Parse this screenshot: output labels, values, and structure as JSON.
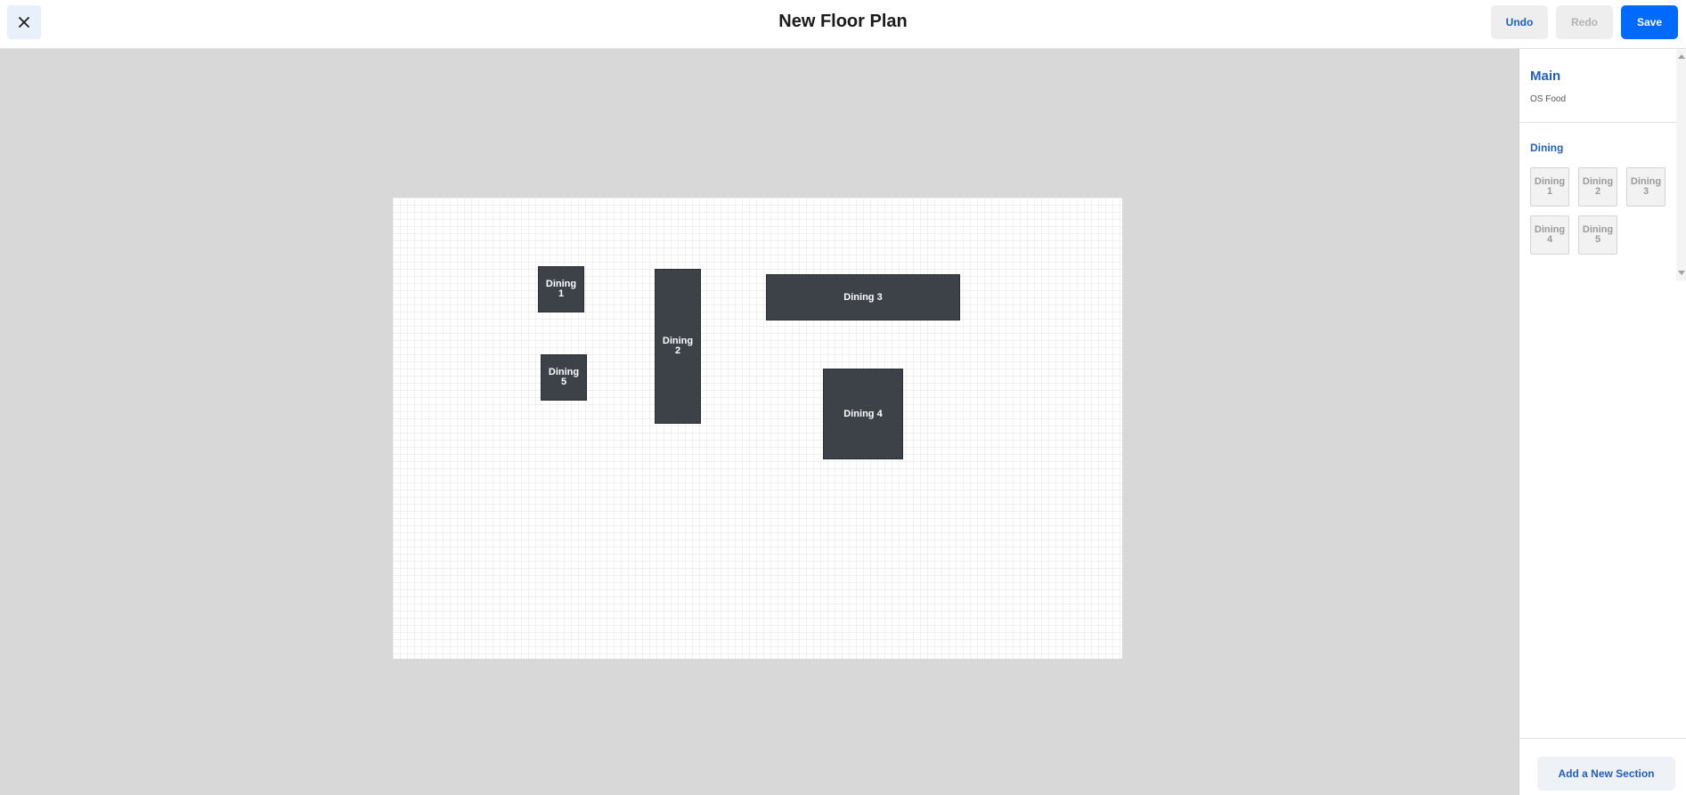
{
  "header": {
    "title": "New Floor Plan",
    "undo_label": "Undo",
    "redo_label": "Redo",
    "save_label": "Save"
  },
  "canvas": {
    "tables": [
      {
        "line1": "Dining",
        "line2": "1"
      },
      {
        "line1": "Dining",
        "line2": "2"
      },
      {
        "label": "Dining 3"
      },
      {
        "label": "Dining 4"
      },
      {
        "line1": "Dining",
        "line2": "5"
      }
    ]
  },
  "panel": {
    "section_title": "Main",
    "section_subtitle": "OS Food",
    "group_label": "Dining",
    "thumbnails": [
      {
        "line1": "Dining",
        "line2": "1"
      },
      {
        "line1": "Dining",
        "line2": "2"
      },
      {
        "line1": "Dining",
        "line2": "3"
      },
      {
        "line1": "Dining",
        "line2": "4"
      },
      {
        "line1": "Dining",
        "line2": "5"
      }
    ],
    "add_section_label": "Add a New Section"
  },
  "icons": {
    "close": "close-icon"
  },
  "colors": {
    "accent": "#006aff",
    "link": "#1f5fbf",
    "table": "#3d4249"
  }
}
